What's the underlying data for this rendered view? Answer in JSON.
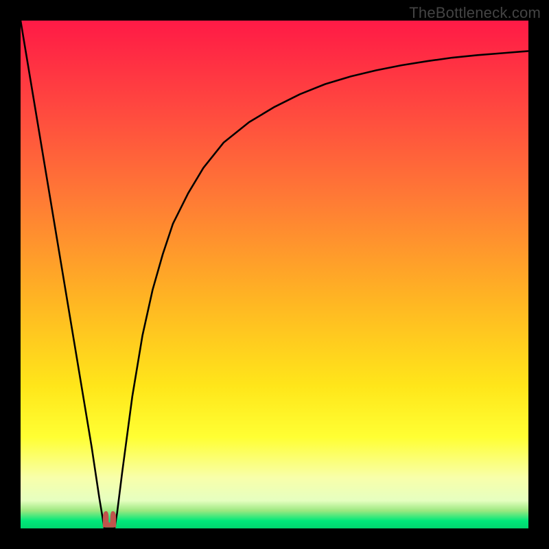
{
  "watermark": "TheBottleneck.com",
  "chart_data": {
    "type": "line",
    "title": "",
    "xlabel": "",
    "ylabel": "",
    "xlim": [
      0,
      100
    ],
    "ylim": [
      0,
      100
    ],
    "grid": false,
    "legend": false,
    "background_gradient": {
      "stops": [
        {
          "pos": 0.0,
          "color": "#ff1a46"
        },
        {
          "pos": 0.18,
          "color": "#ff4a3f"
        },
        {
          "pos": 0.35,
          "color": "#ff7a35"
        },
        {
          "pos": 0.55,
          "color": "#ffb523"
        },
        {
          "pos": 0.72,
          "color": "#ffe61a"
        },
        {
          "pos": 0.82,
          "color": "#ffff33"
        },
        {
          "pos": 0.9,
          "color": "#f8ffaa"
        },
        {
          "pos": 0.945,
          "color": "#e6ffc0"
        },
        {
          "pos": 0.965,
          "color": "#9CE880"
        },
        {
          "pos": 0.985,
          "color": "#00e87a"
        },
        {
          "pos": 1.0,
          "color": "#00d66e"
        }
      ]
    },
    "series": [
      {
        "name": "bottleneck-curve",
        "color": "#000000",
        "x": [
          0,
          2,
          4,
          6,
          8,
          10,
          12,
          14,
          15.5,
          16.5,
          17.5,
          18.5,
          19,
          20,
          22,
          24,
          26,
          28,
          30,
          33,
          36,
          40,
          45,
          50,
          55,
          60,
          65,
          70,
          75,
          80,
          85,
          90,
          95,
          100
        ],
        "values": [
          100,
          88,
          76,
          64,
          52,
          40,
          28,
          16,
          6,
          0,
          0,
          0,
          3,
          11,
          26,
          38,
          47,
          54,
          60,
          66,
          71,
          76,
          80,
          83,
          85.5,
          87.5,
          89,
          90.2,
          91.2,
          92,
          92.7,
          93.2,
          93.6,
          94
        ]
      }
    ],
    "marker": {
      "name": "minimum-marker",
      "center_x": 17.5,
      "half_width": 1.3,
      "lobe_height": 3.2,
      "inner_depth_ratio": 0.55,
      "y_bottom": 0.2,
      "color": "#c0544c"
    }
  }
}
